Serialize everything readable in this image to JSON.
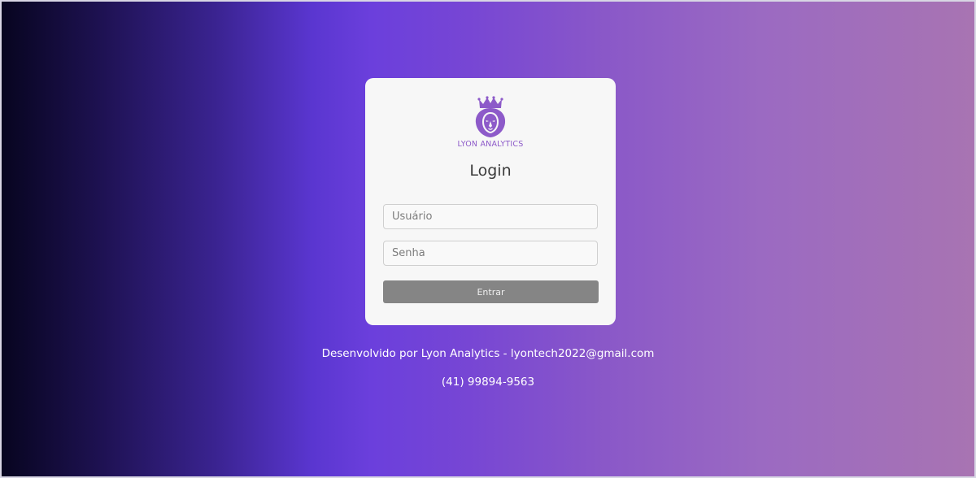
{
  "login": {
    "logo": {
      "icon": "lion-crown-icon",
      "brand": "LYON ANALYTICS"
    },
    "title": "Login",
    "username": {
      "placeholder": "Usuário",
      "value": ""
    },
    "password": {
      "placeholder": "Senha",
      "value": ""
    },
    "submit_label": "Entrar"
  },
  "footer": {
    "credit": "Desenvolvido por Lyon Analytics - lyontech2022@gmail.com",
    "phone": "(41) 99894-9563"
  },
  "colors": {
    "accent": "#8d5ac9",
    "button": "#858585",
    "card": "#f7f7f7"
  }
}
